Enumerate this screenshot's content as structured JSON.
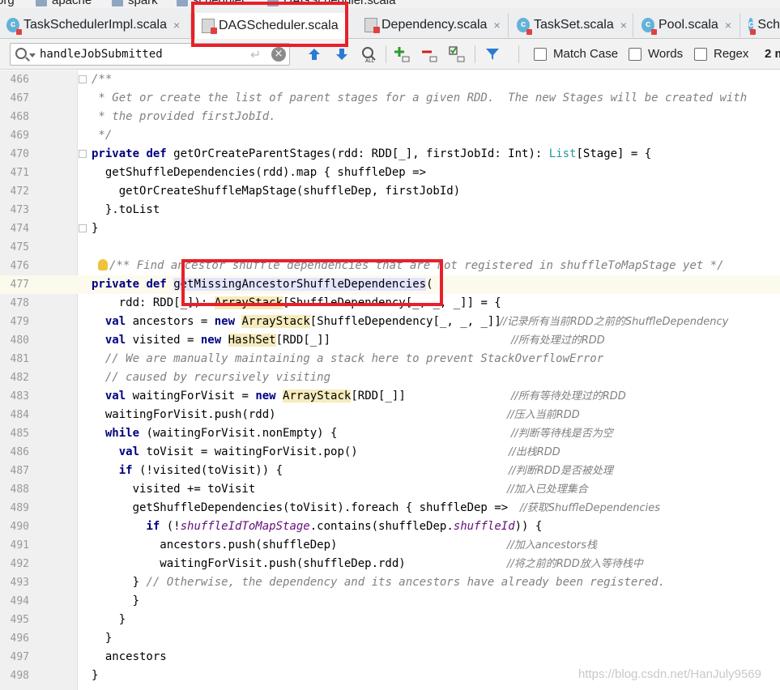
{
  "breadcrumb": [
    "org",
    "apache",
    "spark",
    "scheduler",
    "DAGScheduler.scala"
  ],
  "tabs": [
    {
      "label": "TaskSchedulerImpl.scala",
      "icon": "scala-class-icon",
      "active": false
    },
    {
      "label": "DAGScheduler.scala",
      "icon": "scala-file-icon",
      "active": true
    },
    {
      "label": "Dependency.scala",
      "icon": "scala-file-icon",
      "active": false
    },
    {
      "label": "TaskSet.scala",
      "icon": "scala-class-icon",
      "active": false
    },
    {
      "label": "Pool.scala",
      "icon": "scala-class-icon",
      "active": false
    },
    {
      "label": "Sch",
      "icon": "scala-class-icon",
      "active": false
    }
  ],
  "tab_close_glyph": "×",
  "search": {
    "value": "handleJobSubmitted",
    "enter_glyph": "↵",
    "clear_glyph": "×",
    "options": [
      {
        "label": "Match Case",
        "checked": false
      },
      {
        "label": "Words",
        "checked": false
      },
      {
        "label": "Regex",
        "checked": false
      }
    ],
    "match_count": "2 m"
  },
  "code_lines": [
    {
      "n": "466",
      "text": "/**"
    },
    {
      "n": "467",
      "text": " * Get or create the list of parent stages for a given RDD.  The new Stages will be created with"
    },
    {
      "n": "468",
      "text": " * the provided firstJobId."
    },
    {
      "n": "469",
      "text": " */"
    },
    {
      "n": "470",
      "text": "private def getOrCreateParentStages(rdd: RDD[_], firstJobId: Int): List[Stage] = {"
    },
    {
      "n": "471",
      "text": "  getShuffleDependencies(rdd).map { shuffleDep =>"
    },
    {
      "n": "472",
      "text": "    getOrCreateShuffleMapStage(shuffleDep, firstJobId)"
    },
    {
      "n": "473",
      "text": "  }.toList"
    },
    {
      "n": "474",
      "text": "}"
    },
    {
      "n": "475",
      "text": ""
    },
    {
      "n": "476",
      "text": "/** Find ancestor shuffle dependencies that are not registered in shuffleToMapStage yet */"
    },
    {
      "n": "477",
      "text": "private def getMissingAncestorShuffleDependencies("
    },
    {
      "n": "478",
      "text": "    rdd: RDD[_]): ArrayStack[ShuffleDependency[_, _, _]] = {"
    },
    {
      "n": "479",
      "text": "  val ancestors = new ArrayStack[ShuffleDependency[_, _, _]]"
    },
    {
      "n": "480",
      "text": "  val visited = new HashSet[RDD[_]]"
    },
    {
      "n": "481",
      "text": "  // We are manually maintaining a stack here to prevent StackOverflowError"
    },
    {
      "n": "482",
      "text": "  // caused by recursively visiting"
    },
    {
      "n": "483",
      "text": "  val waitingForVisit = new ArrayStack[RDD[_]]"
    },
    {
      "n": "484",
      "text": "  waitingForVisit.push(rdd)"
    },
    {
      "n": "485",
      "text": "  while (waitingForVisit.nonEmpty) {"
    },
    {
      "n": "486",
      "text": "    val toVisit = waitingForVisit.pop()"
    },
    {
      "n": "487",
      "text": "    if (!visited(toVisit)) {"
    },
    {
      "n": "488",
      "text": "      visited += toVisit"
    },
    {
      "n": "489",
      "text": "      getShuffleDependencies(toVisit).foreach { shuffleDep =>"
    },
    {
      "n": "490",
      "text": "        if (!shuffleIdToMapStage.contains(shuffleDep.shuffleId)) {"
    },
    {
      "n": "491",
      "text": "          ancestors.push(shuffleDep)"
    },
    {
      "n": "492",
      "text": "          waitingForVisit.push(shuffleDep.rdd)"
    },
    {
      "n": "493",
      "text": "      } // Otherwise, the dependency and its ancestors have already been registered."
    },
    {
      "n": "494",
      "text": "      }"
    },
    {
      "n": "495",
      "text": "    }"
    },
    {
      "n": "496",
      "text": "  }"
    },
    {
      "n": "497",
      "text": "  ancestors"
    },
    {
      "n": "498",
      "text": "}"
    }
  ],
  "zh_comments": {
    "479": "//记录所有当前RDD之前的ShuffleDependency",
    "480": "//所有处理过的RDD",
    "483": "//所有等待处理过的RDD",
    "484": "//压入当前RDD",
    "485": "//判断等待栈是否为空",
    "486": "//出栈RDD",
    "487": "//判断RDD是否被处理",
    "488": "//加入已处理集合",
    "489": "//获取ShuffleDependencies",
    "491": "//加入ancestors栈",
    "492": "//将之前的RDD放入等待栈中"
  },
  "watermark": "https://blog.csdn.net/HanJuly9569",
  "colors": {
    "keyword": "#000080",
    "comment": "#808080",
    "type": "#20999d",
    "annotation_red": "#e8202a",
    "field_purple": "#660e7a"
  }
}
